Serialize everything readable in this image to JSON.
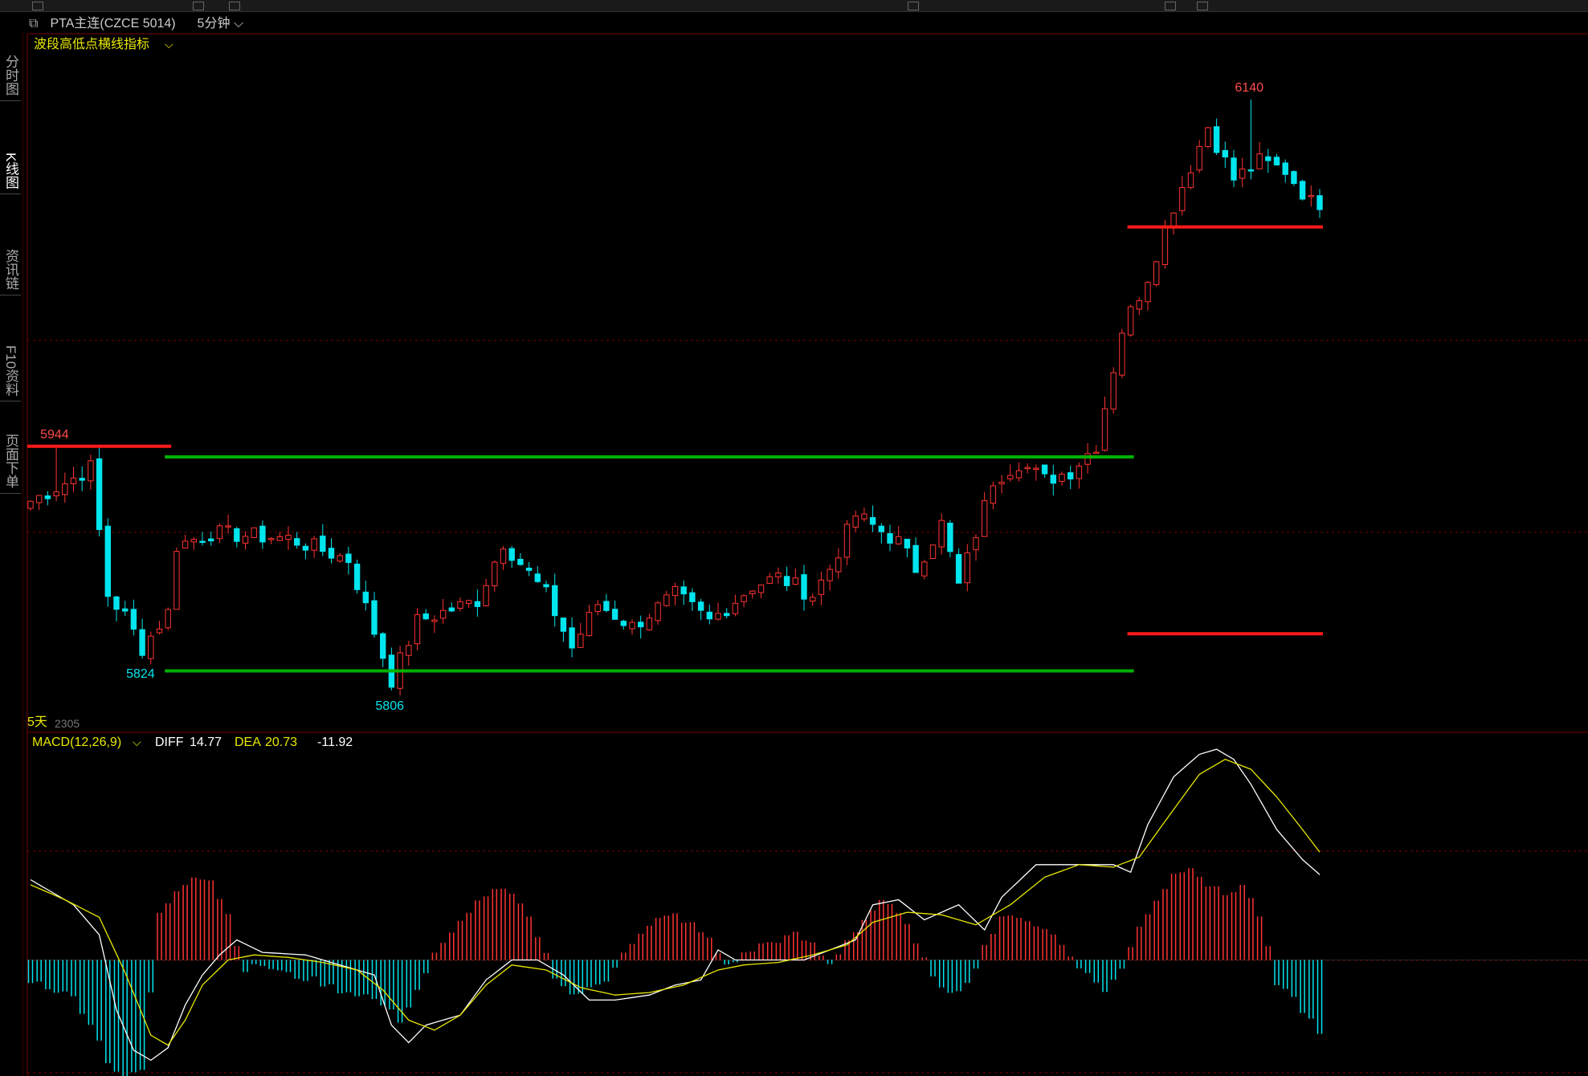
{
  "header": {
    "link_icon": "link-icon",
    "symbol": "PTA主连(CZCE 5014)",
    "period": "5分钟",
    "indicator": "波段高低点横线指标"
  },
  "sidebar": {
    "tabs": [
      {
        "label": "分时图",
        "active": false
      },
      {
        "label": "K线图",
        "active": true
      },
      {
        "label": "资讯链",
        "active": false
      },
      {
        "label": "F10资料",
        "active": false
      },
      {
        "label": "页面下单",
        "active": false
      }
    ]
  },
  "colors": {
    "up": "#ff3232",
    "down": "#00e5ee",
    "support": "#00b000",
    "resistance": "#ff1a1a",
    "diff": "#ffffff",
    "dea": "#e8e800",
    "grid": "#7a0000"
  },
  "markers": {
    "contract": "2305",
    "five_day": "5天"
  },
  "chart_data": [
    {
      "type": "candlestick",
      "title": "PTA主连(CZCE 5014) 5分钟",
      "ylim": [
        5790,
        6160
      ],
      "annotations": [
        {
          "label": "6140",
          "index": 142,
          "value": 6140,
          "kind": "high"
        },
        {
          "label": "5944",
          "index": 3,
          "value": 5944,
          "kind": "high"
        },
        {
          "label": "5824",
          "index": 13,
          "value": 5824,
          "kind": "low"
        },
        {
          "label": "5806",
          "index": 42,
          "value": 5806,
          "kind": "low"
        }
      ],
      "horizontal_lines": [
        {
          "value": 5944,
          "from": 0,
          "to": 16,
          "color": "resistance"
        },
        {
          "value": 5938,
          "from": 16,
          "to": 128,
          "color": "support"
        },
        {
          "value": 5817,
          "from": 16,
          "to": 128,
          "color": "support"
        },
        {
          "value": 6068,
          "from": 128,
          "to": 150,
          "color": "resistance"
        },
        {
          "value": 5838,
          "from": 128,
          "to": 150,
          "color": "resistance"
        }
      ],
      "key_points": [
        [
          0,
          5913
        ],
        [
          5,
          5926
        ],
        [
          7,
          5932
        ],
        [
          9,
          5860
        ],
        [
          11,
          5848
        ],
        [
          13,
          5830
        ],
        [
          16,
          5850
        ],
        [
          17,
          5888
        ],
        [
          21,
          5895
        ],
        [
          30,
          5892
        ],
        [
          37,
          5880
        ],
        [
          42,
          5812
        ],
        [
          45,
          5845
        ],
        [
          52,
          5857
        ],
        [
          55,
          5890
        ],
        [
          60,
          5860
        ],
        [
          63,
          5830
        ],
        [
          66,
          5855
        ],
        [
          70,
          5842
        ],
        [
          75,
          5860
        ],
        [
          79,
          5845
        ],
        [
          84,
          5865
        ],
        [
          87,
          5870
        ],
        [
          91,
          5860
        ],
        [
          93,
          5875
        ],
        [
          96,
          5905
        ],
        [
          101,
          5890
        ],
        [
          103,
          5875
        ],
        [
          106,
          5900
        ],
        [
          108,
          5865
        ],
        [
          112,
          5925
        ],
        [
          115,
          5935
        ],
        [
          118,
          5925
        ],
        [
          121,
          5930
        ],
        [
          124,
          5945
        ],
        [
          127,
          6010
        ],
        [
          130,
          6040
        ],
        [
          133,
          6080
        ],
        [
          137,
          6125
        ],
        [
          140,
          6095
        ],
        [
          143,
          6105
        ],
        [
          146,
          6100
        ],
        [
          149,
          6082
        ]
      ]
    },
    {
      "type": "line",
      "title": "MACD(12,26,9)",
      "legend": [
        {
          "label": "MACD(12,26,9)"
        },
        {
          "label": "DIFF",
          "value": "14.77"
        },
        {
          "label": "DEA",
          "value": "20.73"
        },
        {
          "label": "",
          "value": "-11.92"
        }
      ],
      "ylim": [
        -45,
        85
      ],
      "series": [
        {
          "name": "DIFF",
          "points": [
            [
              0,
              32
            ],
            [
              5,
              22
            ],
            [
              8,
              10
            ],
            [
              10,
              -20
            ],
            [
              12,
              -36
            ],
            [
              14,
              -40
            ],
            [
              16,
              -35
            ],
            [
              18,
              -18
            ],
            [
              20,
              -6
            ],
            [
              22,
              2
            ],
            [
              24,
              8
            ],
            [
              27,
              3
            ],
            [
              32,
              2
            ],
            [
              36,
              -2
            ],
            [
              40,
              -6
            ],
            [
              42,
              -26
            ],
            [
              44,
              -33
            ],
            [
              46,
              -26
            ],
            [
              50,
              -22
            ],
            [
              53,
              -8
            ],
            [
              56,
              0
            ],
            [
              59,
              0
            ],
            [
              62,
              -6
            ],
            [
              65,
              -16
            ],
            [
              68,
              -16
            ],
            [
              72,
              -14
            ],
            [
              75,
              -10
            ],
            [
              78,
              -8
            ],
            [
              80,
              4
            ],
            [
              82,
              0
            ],
            [
              86,
              0
            ],
            [
              90,
              0
            ],
            [
              93,
              4
            ],
            [
              96,
              8
            ],
            [
              98,
              22
            ],
            [
              101,
              24
            ],
            [
              104,
              16
            ],
            [
              108,
              22
            ],
            [
              111,
              12
            ],
            [
              113,
              25
            ],
            [
              117,
              38
            ],
            [
              120,
              38
            ],
            [
              123,
              38
            ],
            [
              126,
              38
            ],
            [
              128,
              35
            ],
            [
              130,
              54
            ],
            [
              133,
              73
            ],
            [
              136,
              82
            ],
            [
              138,
              84
            ],
            [
              140,
              80
            ],
            [
              142,
              70
            ],
            [
              145,
              52
            ],
            [
              148,
              40
            ],
            [
              150,
              34
            ]
          ]
        },
        {
          "name": "DEA",
          "points": [
            [
              0,
              30
            ],
            [
              4,
              24
            ],
            [
              8,
              17
            ],
            [
              11,
              -5
            ],
            [
              14,
              -30
            ],
            [
              16,
              -34
            ],
            [
              18,
              -24
            ],
            [
              20,
              -10
            ],
            [
              23,
              0
            ],
            [
              26,
              2
            ],
            [
              30,
              1
            ],
            [
              34,
              -1
            ],
            [
              38,
              -4
            ],
            [
              41,
              -12
            ],
            [
              44,
              -24
            ],
            [
              47,
              -28
            ],
            [
              50,
              -22
            ],
            [
              53,
              -10
            ],
            [
              56,
              -2
            ],
            [
              60,
              -4
            ],
            [
              64,
              -11
            ],
            [
              68,
              -14
            ],
            [
              72,
              -13
            ],
            [
              76,
              -10
            ],
            [
              80,
              -4
            ],
            [
              83,
              -2
            ],
            [
              87,
              -1
            ],
            [
              91,
              2
            ],
            [
              95,
              6
            ],
            [
              98,
              15
            ],
            [
              102,
              19
            ],
            [
              106,
              18
            ],
            [
              110,
              14
            ],
            [
              114,
              22
            ],
            [
              118,
              33
            ],
            [
              122,
              38
            ],
            [
              126,
              37
            ],
            [
              129,
              41
            ],
            [
              133,
              60
            ],
            [
              136,
              74
            ],
            [
              139,
              80
            ],
            [
              142,
              76
            ],
            [
              145,
              65
            ],
            [
              148,
              52
            ],
            [
              150,
              43
            ]
          ]
        }
      ],
      "histogram": [
        [
          0,
          -8
        ],
        [
          3,
          -12
        ],
        [
          5,
          -15
        ],
        [
          7,
          -25
        ],
        [
          9,
          -40
        ],
        [
          11,
          -48
        ],
        [
          13,
          -44
        ],
        [
          15,
          18
        ],
        [
          17,
          28
        ],
        [
          19,
          34
        ],
        [
          21,
          32
        ],
        [
          23,
          18
        ],
        [
          25,
          -4
        ],
        [
          27,
          -2
        ],
        [
          30,
          -6
        ],
        [
          33,
          -8
        ],
        [
          36,
          -12
        ],
        [
          39,
          -14
        ],
        [
          41,
          -18
        ],
        [
          43,
          -24
        ],
        [
          45,
          -12
        ],
        [
          47,
          2
        ],
        [
          49,
          10
        ],
        [
          51,
          20
        ],
        [
          53,
          26
        ],
        [
          55,
          28
        ],
        [
          57,
          22
        ],
        [
          59,
          10
        ],
        [
          61,
          -6
        ],
        [
          63,
          -14
        ],
        [
          65,
          -12
        ],
        [
          67,
          -8
        ],
        [
          69,
          4
        ],
        [
          71,
          10
        ],
        [
          73,
          16
        ],
        [
          75,
          18
        ],
        [
          77,
          14
        ],
        [
          79,
          8
        ],
        [
          81,
          -2
        ],
        [
          83,
          2
        ],
        [
          85,
          6
        ],
        [
          87,
          8
        ],
        [
          89,
          10
        ],
        [
          91,
          6
        ],
        [
          93,
          -2
        ],
        [
          95,
          8
        ],
        [
          97,
          16
        ],
        [
          99,
          24
        ],
        [
          101,
          18
        ],
        [
          103,
          8
        ],
        [
          105,
          -8
        ],
        [
          107,
          -12
        ],
        [
          109,
          -10
        ],
        [
          111,
          6
        ],
        [
          113,
          16
        ],
        [
          115,
          18
        ],
        [
          117,
          14
        ],
        [
          119,
          10
        ],
        [
          121,
          2
        ],
        [
          123,
          -6
        ],
        [
          125,
          -12
        ],
        [
          127,
          -4
        ],
        [
          129,
          14
        ],
        [
          131,
          24
        ],
        [
          133,
          34
        ],
        [
          135,
          38
        ],
        [
          137,
          30
        ],
        [
          139,
          26
        ],
        [
          141,
          30
        ],
        [
          143,
          18
        ],
        [
          145,
          -10
        ],
        [
          147,
          -16
        ],
        [
          149,
          -24
        ],
        [
          150,
          -30
        ]
      ]
    }
  ]
}
